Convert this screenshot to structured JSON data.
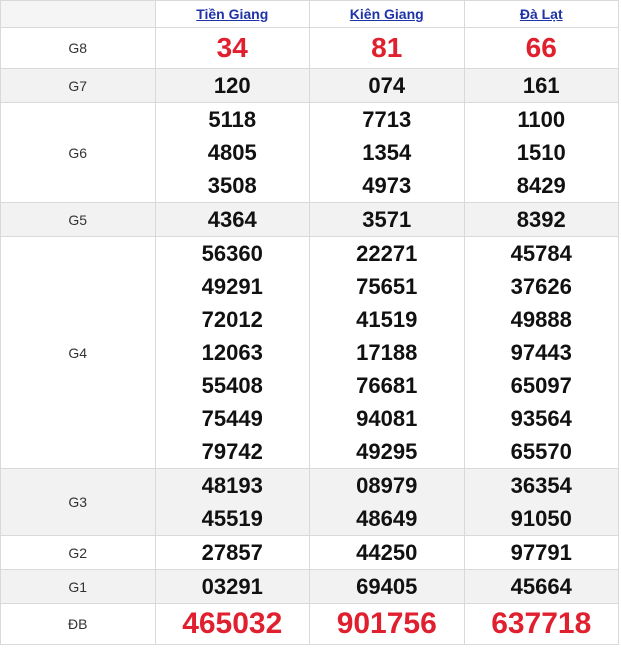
{
  "provinces": [
    "Tiền Giang",
    "Kiên Giang",
    "Đà Lạt"
  ],
  "rows": [
    {
      "label": "G8",
      "values": [
        [
          "34"
        ],
        [
          "81"
        ],
        [
          "66"
        ]
      ],
      "style": "red",
      "alt": false
    },
    {
      "label": "G7",
      "values": [
        [
          "120"
        ],
        [
          "074"
        ],
        [
          "161"
        ]
      ],
      "style": "normal",
      "alt": true
    },
    {
      "label": "G6",
      "values": [
        [
          "5118",
          "4805",
          "3508"
        ],
        [
          "7713",
          "1354",
          "4973"
        ],
        [
          "1100",
          "1510",
          "8429"
        ]
      ],
      "style": "normal",
      "alt": false
    },
    {
      "label": "G5",
      "values": [
        [
          "4364"
        ],
        [
          "3571"
        ],
        [
          "8392"
        ]
      ],
      "style": "normal",
      "alt": true
    },
    {
      "label": "G4",
      "values": [
        [
          "56360",
          "49291",
          "72012",
          "12063",
          "55408",
          "75449",
          "79742"
        ],
        [
          "22271",
          "75651",
          "41519",
          "17188",
          "76681",
          "94081",
          "49295"
        ],
        [
          "45784",
          "37626",
          "49888",
          "97443",
          "65097",
          "93564",
          "65570"
        ]
      ],
      "style": "normal",
      "alt": false
    },
    {
      "label": "G3",
      "values": [
        [
          "48193",
          "45519"
        ],
        [
          "08979",
          "48649"
        ],
        [
          "36354",
          "91050"
        ]
      ],
      "style": "normal",
      "alt": true
    },
    {
      "label": "G2",
      "values": [
        [
          "27857"
        ],
        [
          "44250"
        ],
        [
          "97791"
        ]
      ],
      "style": "normal",
      "alt": false
    },
    {
      "label": "G1",
      "values": [
        [
          "03291"
        ],
        [
          "69405"
        ],
        [
          "45664"
        ]
      ],
      "style": "normal",
      "alt": true
    },
    {
      "label": "ĐB",
      "values": [
        [
          "465032"
        ],
        [
          "901756"
        ],
        [
          "637718"
        ]
      ],
      "style": "red-big",
      "alt": false
    }
  ]
}
